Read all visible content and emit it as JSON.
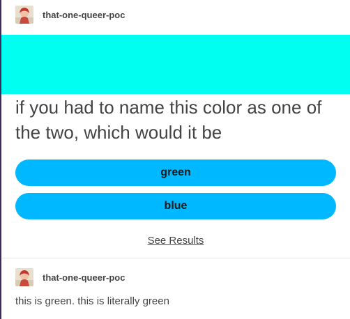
{
  "post": {
    "username": "that-one-queer-poc",
    "swatch_color": "#00fff0",
    "poll": {
      "question": "if you had to name this color as one of the two, which would it be",
      "options": [
        "green",
        "blue"
      ],
      "option_color": "#00b8ff",
      "see_results_label": "See Results"
    }
  },
  "reply": {
    "username": "that-one-queer-poc",
    "text": "this is green. this is literally green"
  }
}
